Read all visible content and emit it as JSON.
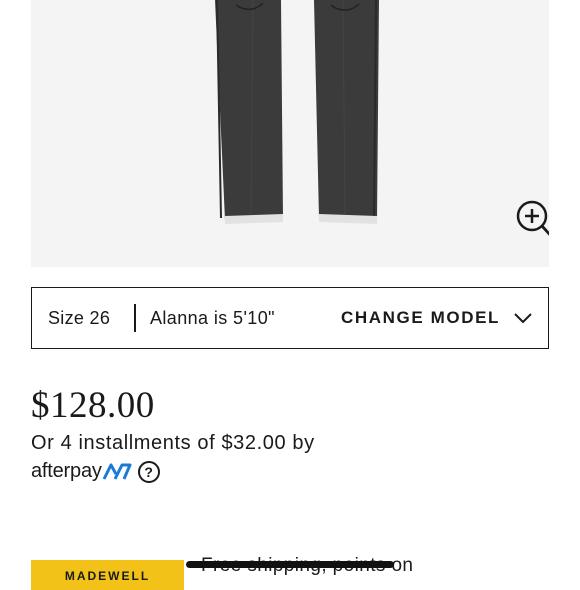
{
  "product": {
    "image_alt_icon": "jeans-image",
    "zoom_icon": "zoom-in-icon"
  },
  "model_bar": {
    "size": "Size 26",
    "model": "Alanna is 5'10\"",
    "change_label": "CHANGE MODEL",
    "chevron_icon": "chevron-down-icon"
  },
  "pricing": {
    "price": "$128.00",
    "installments": "Or 4 installments of $32.00 by",
    "afterpay_label": "afterpay",
    "help_symbol": "?"
  },
  "rewards": {
    "card_label": "MADEWELL",
    "shipping_text": "Free shipping, points on"
  },
  "colors": {
    "accent_yellow": "#f2c218",
    "afterpay_blue": "#1a7bd6",
    "text": "#1a1a1a"
  }
}
